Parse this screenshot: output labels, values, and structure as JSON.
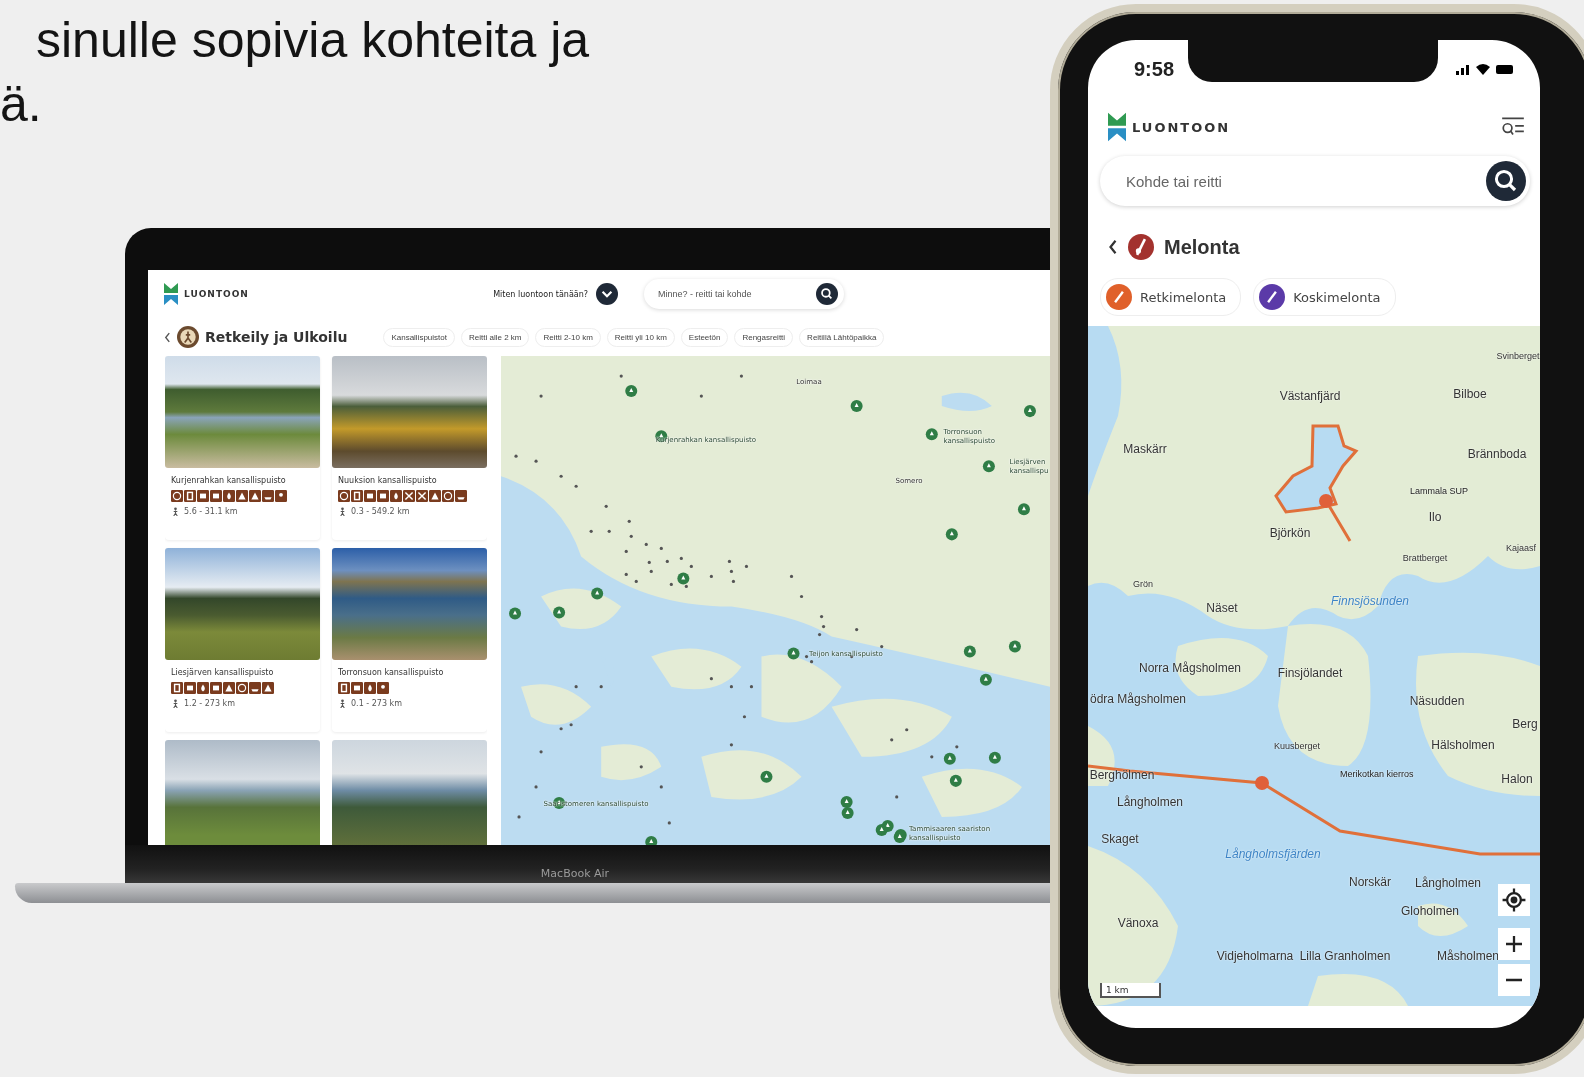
{
  "headline": {
    "lines": [
      "sinulle sopivia kohteita ja",
      "ä."
    ]
  },
  "laptop": {
    "label": "MacBook Air",
    "header": {
      "brand": "LUONTOON",
      "question": "Miten luontoon tänään?",
      "search": {
        "placeholder": "Minne? - reitti tai kohde"
      }
    },
    "category": {
      "title": "Retkeily ja Ulkoilu",
      "filters": [
        {
          "label": "Kansallispuistot",
          "selected": false
        },
        {
          "label": "Reitti alle 2 km",
          "selected": false
        },
        {
          "label": "Reitti 2-10 km",
          "selected": false
        },
        {
          "label": "Reitti yli 10 km",
          "selected": false
        },
        {
          "label": "Esteetön",
          "selected": false
        },
        {
          "label": "Rengasreitti",
          "selected": false
        },
        {
          "label": "Reitillä Lähtöpaikka",
          "selected": false
        }
      ]
    },
    "cards": [
      {
        "title": "Kurjenrahkan kansallispuisto",
        "distance": "5.6 - 31.1 km",
        "amenities": [
          {
            "kind": "info"
          },
          {
            "kind": "parking"
          },
          {
            "kind": "toilet"
          },
          {
            "kind": "table"
          },
          {
            "kind": "fire"
          },
          {
            "kind": "camp"
          },
          {
            "kind": "hut"
          },
          {
            "kind": "boat"
          },
          {
            "kind": "hiker"
          }
        ]
      },
      {
        "title": "Nuuksion kansallispuisto",
        "distance": "0.3 - 549.2 km",
        "amenities": [
          {
            "kind": "info"
          },
          {
            "kind": "parking"
          },
          {
            "kind": "toilet"
          },
          {
            "kind": "table"
          },
          {
            "kind": "fire"
          },
          {
            "kind": "ski"
          },
          {
            "kind": "bike"
          },
          {
            "kind": "camp"
          },
          {
            "kind": "info"
          },
          {
            "kind": "boat"
          }
        ]
      },
      {
        "title": "Liesjärven kansallispuisto",
        "distance": "1.2 - 273 km",
        "amenities": [
          {
            "kind": "parking"
          },
          {
            "kind": "toilet"
          },
          {
            "kind": "fire"
          },
          {
            "kind": "table"
          },
          {
            "kind": "camp"
          },
          {
            "kind": "info"
          },
          {
            "kind": "boat"
          },
          {
            "kind": "hut"
          }
        ]
      },
      {
        "title": "Torronsuon kansallispuisto",
        "distance": "0.1 - 273 km",
        "amenities": [
          {
            "kind": "parking"
          },
          {
            "kind": "toilet"
          },
          {
            "kind": "fire"
          },
          {
            "kind": "hiker"
          }
        ]
      }
    ],
    "map": {
      "labels": [
        {
          "text": "Loimaa",
          "kind": "town"
        },
        {
          "text": "Kurjenrahkan kansallispuisto",
          "kind": "park"
        },
        {
          "text": "Torronsuon kansallispuisto",
          "kind": "park"
        },
        {
          "text": "Liesjärven kansallispu",
          "kind": "park"
        },
        {
          "text": "Somero",
          "kind": "town"
        },
        {
          "text": "Teijon kansallispuisto",
          "kind": "park"
        },
        {
          "text": "Saaristomeren kansallispuisto",
          "kind": "park"
        },
        {
          "text": "Tammisaaren saariston kansallispuisto",
          "kind": "park"
        }
      ]
    }
  },
  "phone": {
    "time": "9:58",
    "brand": "LUONTOON",
    "search": {
      "placeholder": "Kohde tai reitti"
    },
    "title": "Melonta",
    "chips": [
      {
        "label": "Retkimelonta",
        "color": "#e0602a",
        "selected": false
      },
      {
        "label": "Koskimelonta",
        "color": "#5b3aa8",
        "selected": false
      }
    ],
    "map": {
      "labels": [
        {
          "text": "Västanfjärd",
          "kind": "place"
        },
        {
          "text": "Bilboe",
          "kind": "place"
        },
        {
          "text": "Svinberget",
          "kind": "small"
        },
        {
          "text": "Maskärr",
          "kind": "place"
        },
        {
          "text": "Brännboda",
          "kind": "place"
        },
        {
          "text": "Lammala SUP",
          "kind": "route"
        },
        {
          "text": "Ilo",
          "kind": "place"
        },
        {
          "text": "Björkön",
          "kind": "place"
        },
        {
          "text": "Kajaasf",
          "kind": "small"
        },
        {
          "text": "Brattberget",
          "kind": "small"
        },
        {
          "text": "Grön",
          "kind": "small"
        },
        {
          "text": "Näset",
          "kind": "place"
        },
        {
          "text": "Finnsjösunden",
          "kind": "water"
        },
        {
          "text": "Norra Mågsholmen",
          "kind": "place"
        },
        {
          "text": "Finsjölandet",
          "kind": "place"
        },
        {
          "text": "ödra Mågsholmen",
          "kind": "place"
        },
        {
          "text": "Näsudden",
          "kind": "place"
        },
        {
          "text": "Berg",
          "kind": "place"
        },
        {
          "text": "Kuusberget",
          "kind": "small"
        },
        {
          "text": "Hälsholmen",
          "kind": "place"
        },
        {
          "text": "Berghölmen",
          "kind": "place"
        },
        {
          "text": "Merikotkan kierros",
          "kind": "route"
        },
        {
          "text": "Halon",
          "kind": "place"
        },
        {
          "text": "Långholmen",
          "kind": "place"
        },
        {
          "text": "Skaget",
          "kind": "place"
        },
        {
          "text": "Långholmsfjärden",
          "kind": "water"
        },
        {
          "text": "Norskär",
          "kind": "place"
        },
        {
          "text": "Långholmen",
          "kind": "place"
        },
        {
          "text": "Gloholmen",
          "kind": "place"
        },
        {
          "text": "Vänoxa",
          "kind": "place"
        },
        {
          "text": "Vidjeholmarna",
          "kind": "place"
        },
        {
          "text": "Lilla Granholmen",
          "kind": "place"
        },
        {
          "text": "Måsholmen",
          "kind": "place"
        }
      ],
      "scale": "1 km"
    }
  }
}
